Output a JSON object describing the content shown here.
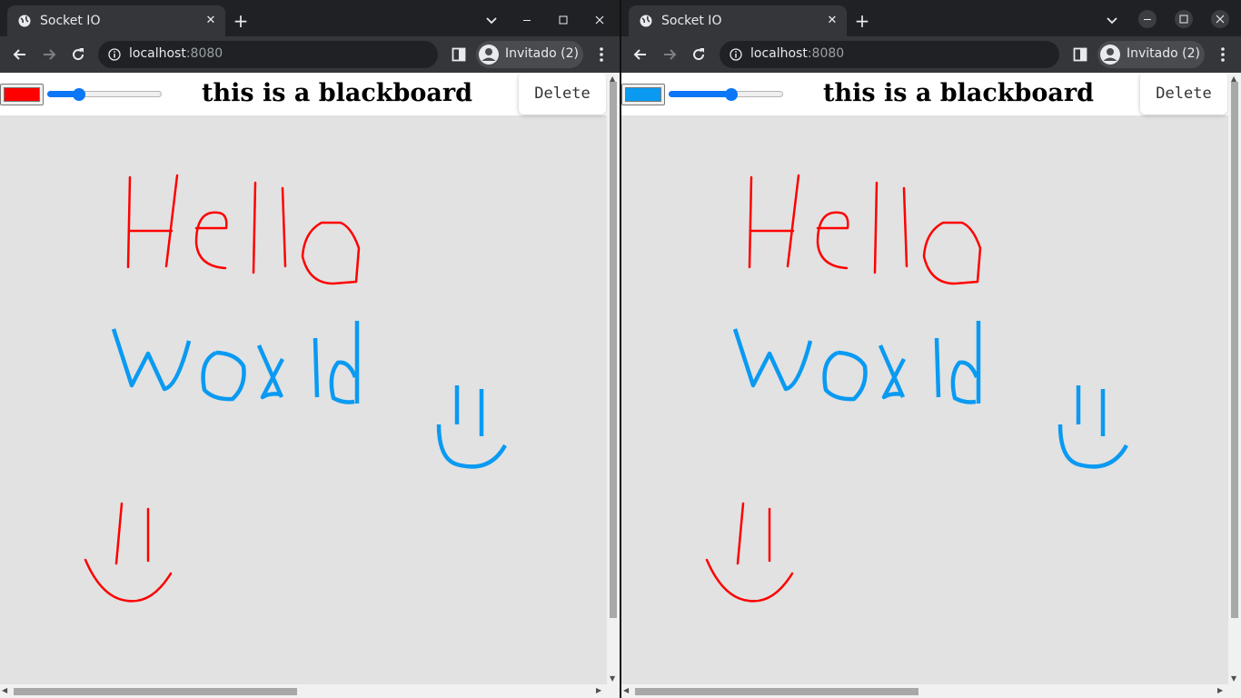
{
  "windows": [
    {
      "tab": {
        "title": "Socket IO",
        "close": "✕",
        "new_tab": "+"
      },
      "toolbar": {
        "url_host": "localhost",
        "url_port": ":8080",
        "profile_label": "Invitado (2)"
      },
      "page": {
        "title": "this is a blackboard",
        "delete_label": "Delete",
        "current_color": "#ff0000",
        "brush_size_fraction": 0.25
      }
    },
    {
      "tab": {
        "title": "Socket IO",
        "close": "✕",
        "new_tab": "+"
      },
      "toolbar": {
        "url_host": "localhost",
        "url_port": ":8080",
        "profile_label": "Invitado (2)"
      },
      "page": {
        "title": "this is a blackboard",
        "delete_label": "Delete",
        "current_color": "#0a9af2",
        "brush_size_fraction": 0.55
      }
    }
  ],
  "drawing": {
    "red_color": "#ff0000",
    "blue_color": "#0a9af2",
    "red_text": "Hello",
    "blue_text": "World"
  },
  "icons": {
    "favicon": "globe-icon",
    "back": "arrow-left-icon",
    "forward": "arrow-right-icon",
    "reload": "reload-icon",
    "info": "info-icon",
    "side_panel": "side-panel-icon",
    "profile": "profile-icon",
    "menu": "three-dots-icon",
    "tab_search": "chevron-down-icon"
  }
}
